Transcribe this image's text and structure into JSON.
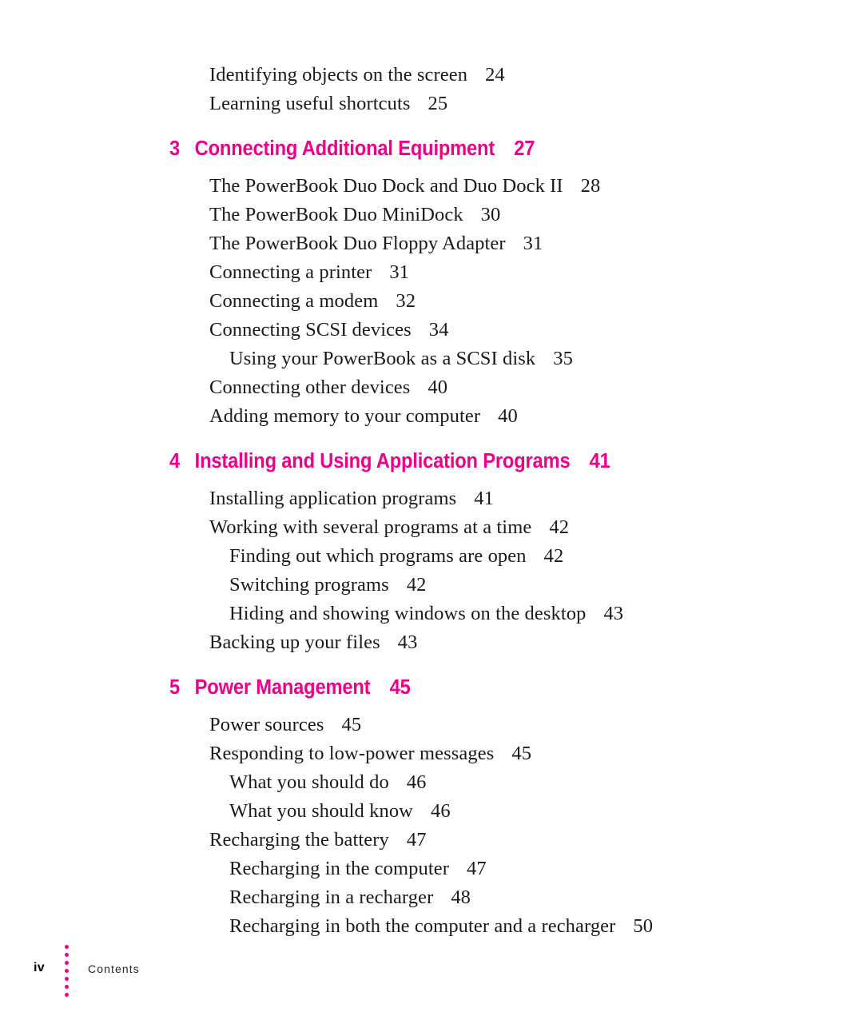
{
  "document": {
    "type": "table-of-contents",
    "accent_color": "#ec008c",
    "text_color": "#1a1a1a"
  },
  "toc": {
    "entries": [
      {
        "kind": "entry",
        "level": 1,
        "title": "Identifying objects on the screen",
        "page": "24"
      },
      {
        "kind": "entry",
        "level": 1,
        "title": "Learning useful shortcuts",
        "page": "25"
      },
      {
        "kind": "chapter",
        "number": "3",
        "title": "Connecting Additional Equipment",
        "page": "27"
      },
      {
        "kind": "entry",
        "level": 1,
        "title": "The PowerBook Duo Dock and Duo Dock II",
        "page": "28"
      },
      {
        "kind": "entry",
        "level": 1,
        "title": "The PowerBook Duo MiniDock",
        "page": "30"
      },
      {
        "kind": "entry",
        "level": 1,
        "title": "The PowerBook Duo Floppy Adapter",
        "page": "31"
      },
      {
        "kind": "entry",
        "level": 1,
        "title": "Connecting a printer",
        "page": "31"
      },
      {
        "kind": "entry",
        "level": 1,
        "title": "Connecting a modem",
        "page": "32"
      },
      {
        "kind": "entry",
        "level": 1,
        "title": "Connecting SCSI devices",
        "page": "34"
      },
      {
        "kind": "entry",
        "level": 2,
        "title": "Using your PowerBook as a SCSI disk",
        "page": "35"
      },
      {
        "kind": "entry",
        "level": 1,
        "title": "Connecting other devices",
        "page": "40"
      },
      {
        "kind": "entry",
        "level": 1,
        "title": "Adding memory to your computer",
        "page": "40"
      },
      {
        "kind": "chapter",
        "number": "4",
        "title": "Installing and Using Application Programs",
        "page": "41"
      },
      {
        "kind": "entry",
        "level": 1,
        "title": "Installing application programs",
        "page": "41"
      },
      {
        "kind": "entry",
        "level": 1,
        "title": "Working with several programs at a time",
        "page": "42"
      },
      {
        "kind": "entry",
        "level": 2,
        "title": "Finding out which programs are open",
        "page": "42"
      },
      {
        "kind": "entry",
        "level": 2,
        "title": "Switching programs",
        "page": "42"
      },
      {
        "kind": "entry",
        "level": 2,
        "title": "Hiding and showing windows on the desktop",
        "page": "43"
      },
      {
        "kind": "entry",
        "level": 1,
        "title": "Backing up your files",
        "page": "43"
      },
      {
        "kind": "chapter",
        "number": "5",
        "title": "Power Management",
        "page": "45"
      },
      {
        "kind": "entry",
        "level": 1,
        "title": "Power sources",
        "page": "45"
      },
      {
        "kind": "entry",
        "level": 1,
        "title": "Responding to low-power messages",
        "page": "45"
      },
      {
        "kind": "entry",
        "level": 2,
        "title": "What you should do",
        "page": "46"
      },
      {
        "kind": "entry",
        "level": 2,
        "title": "What you should know",
        "page": "46"
      },
      {
        "kind": "entry",
        "level": 1,
        "title": "Recharging the battery",
        "page": "47"
      },
      {
        "kind": "entry",
        "level": 2,
        "title": "Recharging in the computer",
        "page": "47"
      },
      {
        "kind": "entry",
        "level": 2,
        "title": "Recharging in a recharger",
        "page": "48"
      },
      {
        "kind": "entry",
        "level": 2,
        "title": "Recharging in both the computer and a recharger",
        "page": "50"
      }
    ]
  },
  "footer": {
    "folio": "iv",
    "label": "Contents",
    "dot_count": 7,
    "dot_color": "#ec008c"
  }
}
